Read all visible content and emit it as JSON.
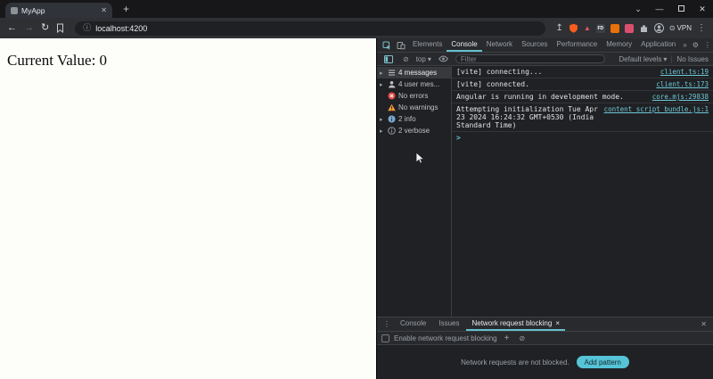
{
  "colors": {
    "accent_teal": "#64c0cf",
    "link_teal": "#6cc8d7",
    "error_red": "#e35049",
    "warning_orange": "#f29a38",
    "brave_orange": "#f75c1e",
    "add_button_bg": "#56c3d6"
  },
  "titlebar": {
    "tab_title": "MyApp",
    "tab_close_glyph": "✕",
    "new_tab_glyph": "+",
    "search_tabs_glyph": "⌄",
    "minimize_glyph": "—",
    "close_window_glyph": "✕"
  },
  "toolbar": {
    "back_glyph": "←",
    "forward_glyph": "→",
    "reload_glyph": "↻",
    "url_info_glyph": "ⓘ",
    "url": "localhost:4200",
    "share_glyph": "↥",
    "rewards_glyph": "▲",
    "ext_fd_label": "FD",
    "vpn_glyph": "⊙",
    "vpn_label": "VPN",
    "menu_glyph": "⋮"
  },
  "page": {
    "text": "Current Value: 0"
  },
  "devtools": {
    "tabs": [
      "Elements",
      "Console",
      "Network",
      "Sources",
      "Performance",
      "Memory",
      "Application"
    ],
    "active_tab": "Console",
    "more_tabs_glyph": "»",
    "settings_glyph": "⚙",
    "menu_glyph": "⋮",
    "close_glyph": "✕",
    "toolbar": {
      "clear_glyph": "⊘",
      "context": "top",
      "caret_glyph": "▾",
      "filter_placeholder": "Filter",
      "levels": "Default levels",
      "issues": "No Issues"
    },
    "sidebar": {
      "items": [
        {
          "arrow": "▸",
          "label": "4 messages"
        },
        {
          "arrow": "▸",
          "label": "4 user mes..."
        },
        {
          "label": "No errors"
        },
        {
          "label": "No warnings"
        },
        {
          "arrow": "▸",
          "label": "2 info"
        },
        {
          "arrow": "▸",
          "label": "2 verbose"
        }
      ]
    },
    "console": {
      "messages": [
        {
          "text": "[vite] connecting...",
          "source": "client.ts:19"
        },
        {
          "text": "[vite] connected.",
          "source": "client.ts:173"
        },
        {
          "text": "Angular is running in development mode.",
          "source": "core.mjs:29838"
        },
        {
          "text": "Attempting initialization Tue Apr 23 2024 16:24:32 GMT+0530 (India Standard Time)",
          "source": "content_script_bundle.js:1"
        }
      ],
      "prompt_glyph": ">"
    },
    "drawer": {
      "menu_glyph": "⋮",
      "tabs": [
        "Console",
        "Issues",
        "Network request blocking"
      ],
      "active_tab": "Network request blocking",
      "tab_close_glyph": "×",
      "close_glyph": "✕",
      "checkbox_label": "Enable network request blocking",
      "add_glyph": "+",
      "block_glyph": "⊘",
      "empty_text": "Network requests are not blocked.",
      "add_button_label": "Add pattern"
    }
  }
}
